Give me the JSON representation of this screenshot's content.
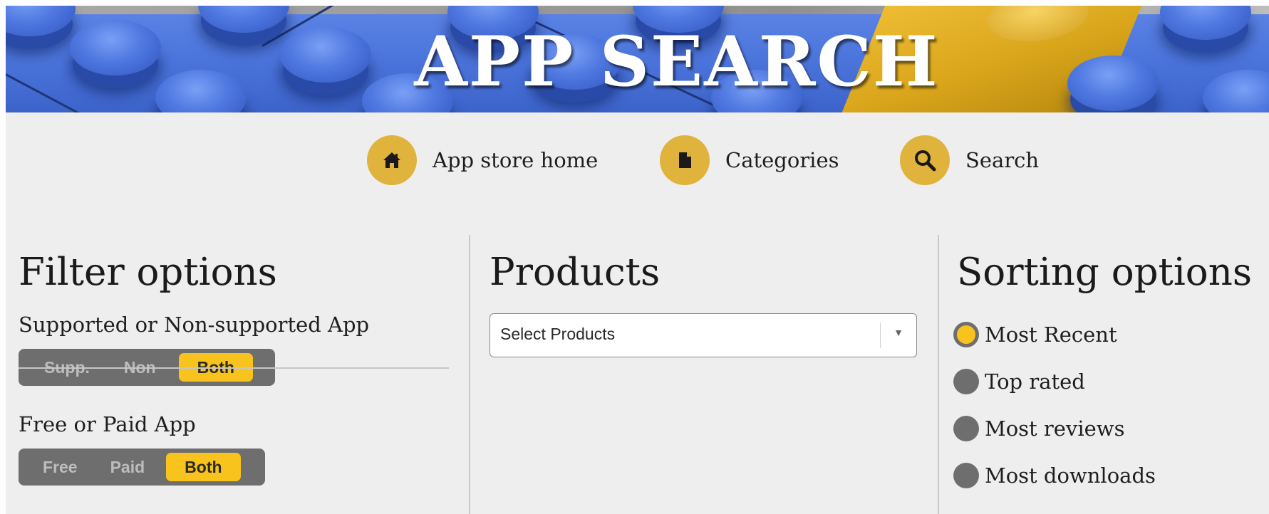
{
  "banner": {
    "title": "APP SEARCH"
  },
  "nav": {
    "items": [
      {
        "label": "App store home",
        "icon": "house-icon"
      },
      {
        "label": "Categories",
        "icon": "document-icon"
      },
      {
        "label": "Search",
        "icon": "magnifier-icon"
      }
    ]
  },
  "filters": {
    "title": "Filter options",
    "support": {
      "label": "Supported or Non-supported App",
      "options": [
        "Supp.",
        "Non",
        "Both"
      ],
      "selected": "Both"
    },
    "price": {
      "label": "Free or Paid App",
      "options": [
        "Free",
        "Paid",
        "Both"
      ],
      "selected": "Both"
    }
  },
  "products": {
    "title": "Products",
    "select": {
      "value": "Select Products"
    }
  },
  "sorting": {
    "title": "Sorting options",
    "options": [
      "Most Recent",
      "Top rated",
      "Most reviews",
      "Most downloads"
    ],
    "selected": "Most Recent"
  },
  "colors": {
    "accent": "#f7c31c",
    "nav_circle": "#e0b33c",
    "toggle_bg": "#6e6e6e",
    "page_bg": "#eeeeee"
  }
}
